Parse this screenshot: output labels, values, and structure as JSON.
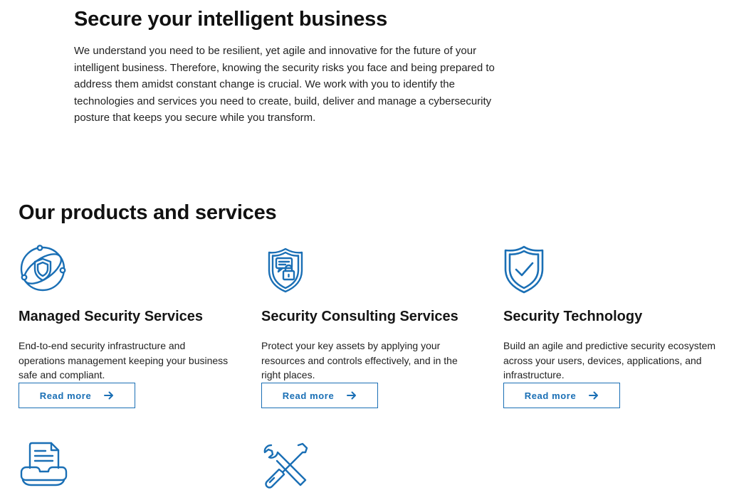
{
  "intro": {
    "title": "Secure your intelligent business",
    "body": "We understand you need to be resilient, yet agile and innovative for the future of your intelligent business. Therefore, knowing the security risks you face and being prepared to address them amidst constant change is crucial. We work with you to identify the technologies and services you need to create, build, deliver and manage a cybersecurity posture that keeps you secure while you transform."
  },
  "products": {
    "title": "Our products and services",
    "cards": [
      {
        "icon": "globe-shield-icon",
        "title": "Managed Security Services",
        "description": " End-to-end security infrastructure and operations management keeping your business safe and compliant.",
        "cta": "Read more"
      },
      {
        "icon": "shield-lock-chat-icon",
        "title": "Security Consulting Services",
        "description": " Protect your key assets by applying your resources and controls effectively, and in the right places.",
        "cta": "Read more"
      },
      {
        "icon": "shield-check-icon",
        "title": "Security Technology",
        "description": "Build an agile and predictive security ecosystem across your users, devices, applications, and infrastructure.",
        "cta": "Read more"
      }
    ],
    "more_icons": [
      "document-hands-icon",
      "tools-icon"
    ]
  },
  "colors": {
    "accent": "#1a6fb5",
    "text": "#111111"
  }
}
